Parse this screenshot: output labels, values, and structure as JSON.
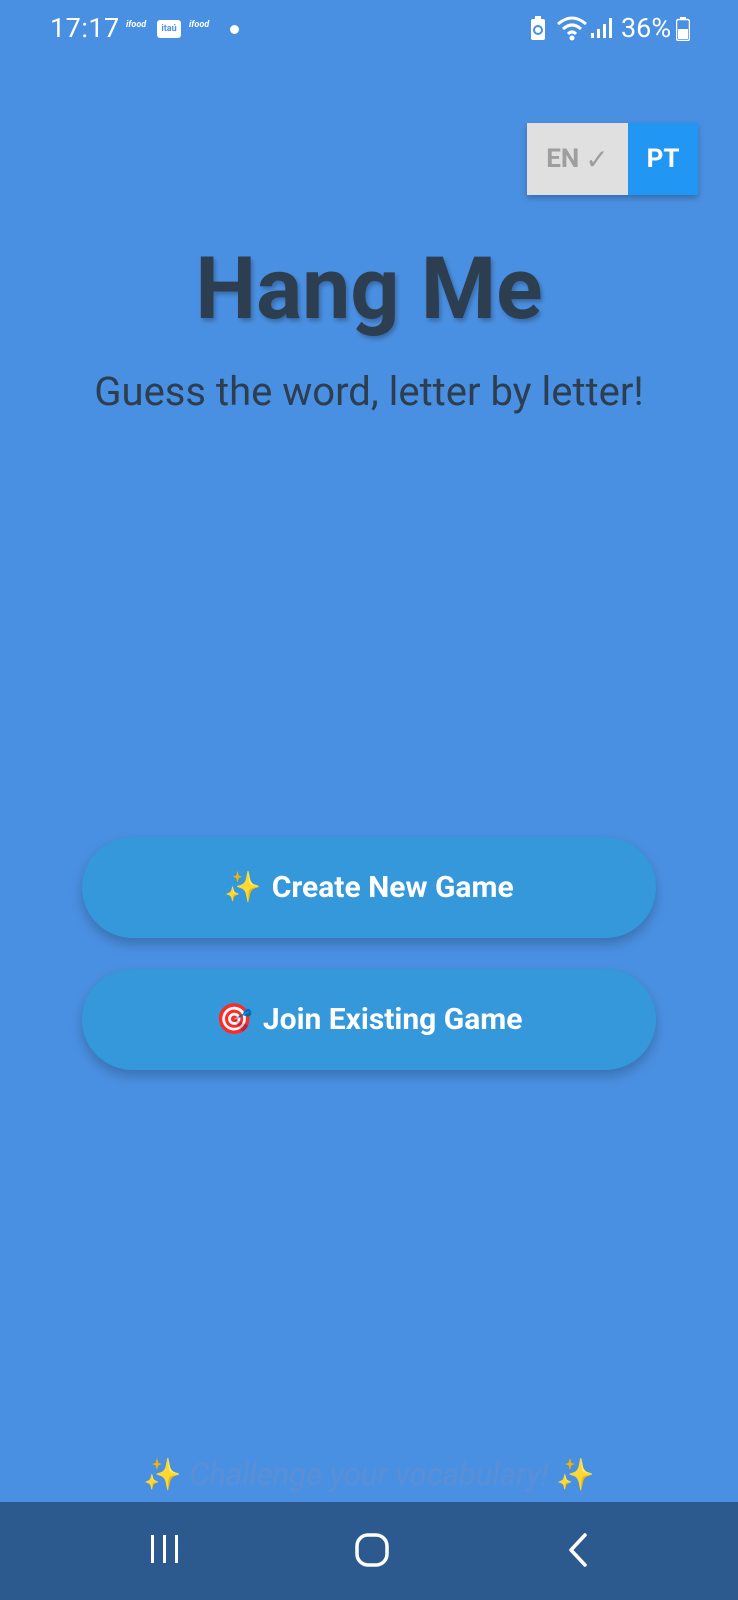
{
  "status_bar": {
    "time": "17:17",
    "ifood_1": "ifood",
    "itau": "itaú",
    "ifood_2": "ifood",
    "battery_percent": "36%"
  },
  "language": {
    "en_label": "EN",
    "en_check": "✓",
    "pt_label": "PT",
    "selected": "EN"
  },
  "header": {
    "title": "Hang Me",
    "subtitle": "Guess the word, letter by letter!"
  },
  "actions": {
    "create_emoji": "✨",
    "create_label": "Create New Game",
    "join_emoji": "🎯",
    "join_label": "Join Existing Game"
  },
  "footer": {
    "sparkle_left": "✨",
    "tagline": "Challenge your vocabulary!",
    "sparkle_right": "✨"
  },
  "colors": {
    "background": "#4a90e2",
    "title": "#2c3e50",
    "button": "#3498db",
    "toggle_active": "#2196f3",
    "toggle_inactive": "#e0e0e0",
    "nav_bar": "#2c5a8f"
  }
}
